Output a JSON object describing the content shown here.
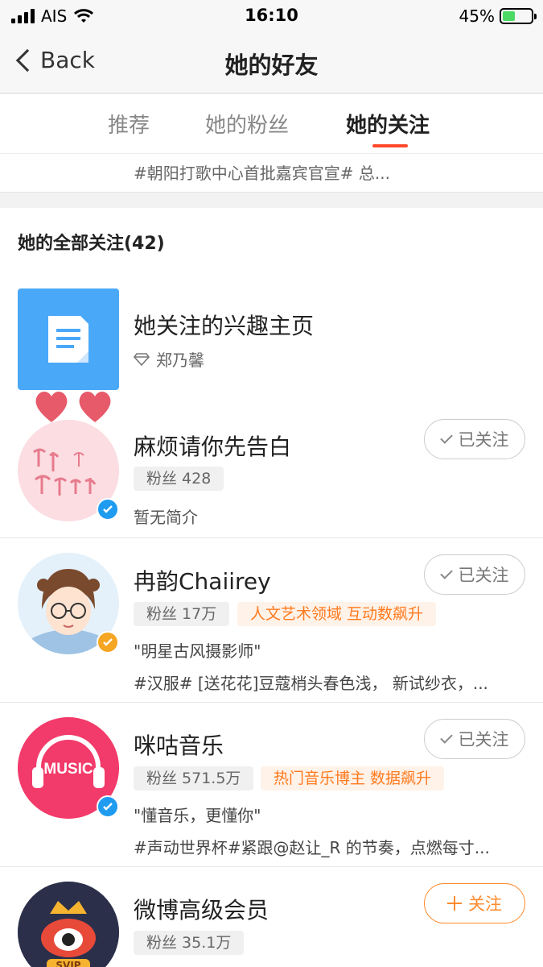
{
  "status_bar": {
    "carrier": "AIS",
    "time": "16:10",
    "battery": "45%"
  },
  "nav": {
    "back_label": "Back",
    "title": "她的好友"
  },
  "tabs": [
    {
      "label": "推荐",
      "active": false
    },
    {
      "label": "她的粉丝",
      "active": false
    },
    {
      "label": "她的关注",
      "active": true
    }
  ],
  "snippet": "#朝阳打歌中心首批嘉宾官宣# 总...",
  "section": {
    "title": "她的全部关注(42)"
  },
  "interest_page": {
    "title": "她关注的兴趣主页",
    "owner": "郑乃馨"
  },
  "follows": [
    {
      "name": "麻烦请你先告白",
      "fans": "粉丝 428",
      "tags": [],
      "bio": "暂无简介",
      "latest": "",
      "button": "已关注",
      "verified": "blue"
    },
    {
      "name": "冉韵Chaiirey",
      "fans": "粉丝 17万",
      "tags": [
        "人文艺术领域 互动数飙升"
      ],
      "bio": "\"明星古风摄影师\"",
      "latest": "#汉服# [送花花]豆蔻梢头春色浅， 新试纱衣，...",
      "button": "已关注",
      "verified": "gold"
    },
    {
      "name": "咪咕音乐",
      "fans": "粉丝 571.5万",
      "tags": [
        "热门音乐博主 数据飙升"
      ],
      "bio": "\"懂音乐，更懂你\"",
      "latest": "#声动世界杯#紧跟@赵让_R 的节奏，点燃每寸...",
      "button": "已关注",
      "verified": "blue"
    },
    {
      "name": "微博高级会员",
      "fans": "粉丝 35.1万",
      "tags": [],
      "bio": "",
      "latest": "",
      "button": "关注",
      "verified": "blue"
    }
  ],
  "avatar_labels": {
    "music_logo": "MUSIC",
    "svip": "SVIP"
  },
  "colors": {
    "accent": "#ff8a2c",
    "tab_indicator": "#ff4a2b",
    "verified_blue": "#1f9bf0",
    "verified_gold": "#f5a623"
  }
}
